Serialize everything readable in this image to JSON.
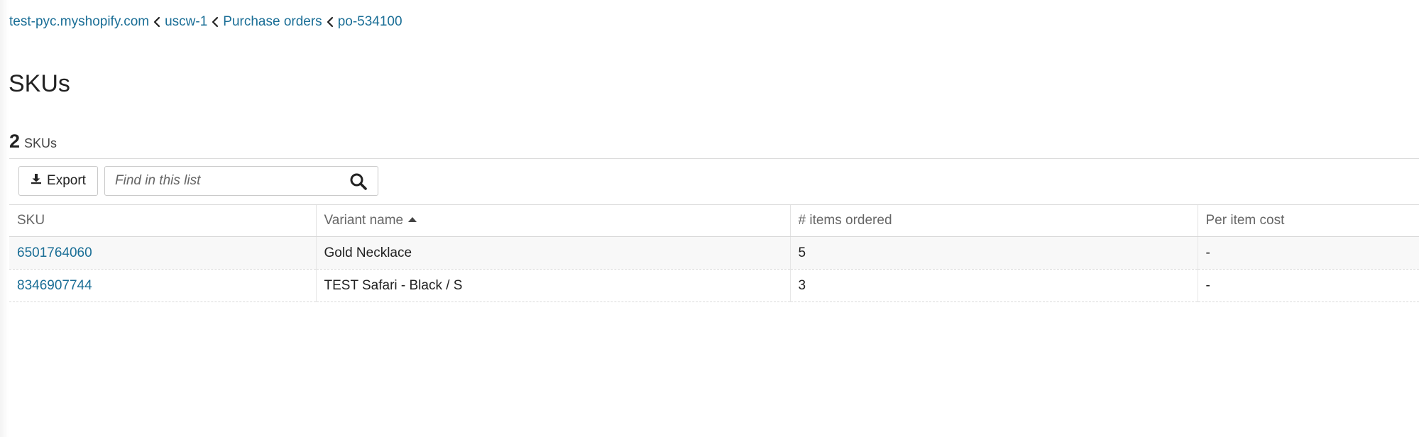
{
  "breadcrumb": {
    "items": [
      "test-pyc.myshopify.com",
      "uscw-1",
      "Purchase orders",
      "po-534100"
    ],
    "separator_icon": "chevron-left-icon"
  },
  "page": {
    "title": "SKUs",
    "count": "2",
    "count_unit": "SKUs"
  },
  "toolbar": {
    "export_label": "Export",
    "export_icon": "download-icon",
    "search_placeholder": "Find in this list",
    "search_value": "",
    "search_icon": "search-icon"
  },
  "table": {
    "columns": [
      "SKU",
      "Variant name",
      "# items ordered",
      "Per item cost"
    ],
    "sorted_column": "Variant name",
    "sort_direction": "ascending",
    "rows": [
      {
        "sku": "6501764060",
        "variant": "Gold Necklace",
        "ordered": "5",
        "cost": "-"
      },
      {
        "sku": "8346907744",
        "variant": "TEST Safari - Black / S",
        "ordered": "3",
        "cost": "-"
      }
    ]
  },
  "colors": {
    "link": "#1a6e96",
    "text": "#222222",
    "header_text": "#666666",
    "row_alt": "#f8f8f8"
  }
}
